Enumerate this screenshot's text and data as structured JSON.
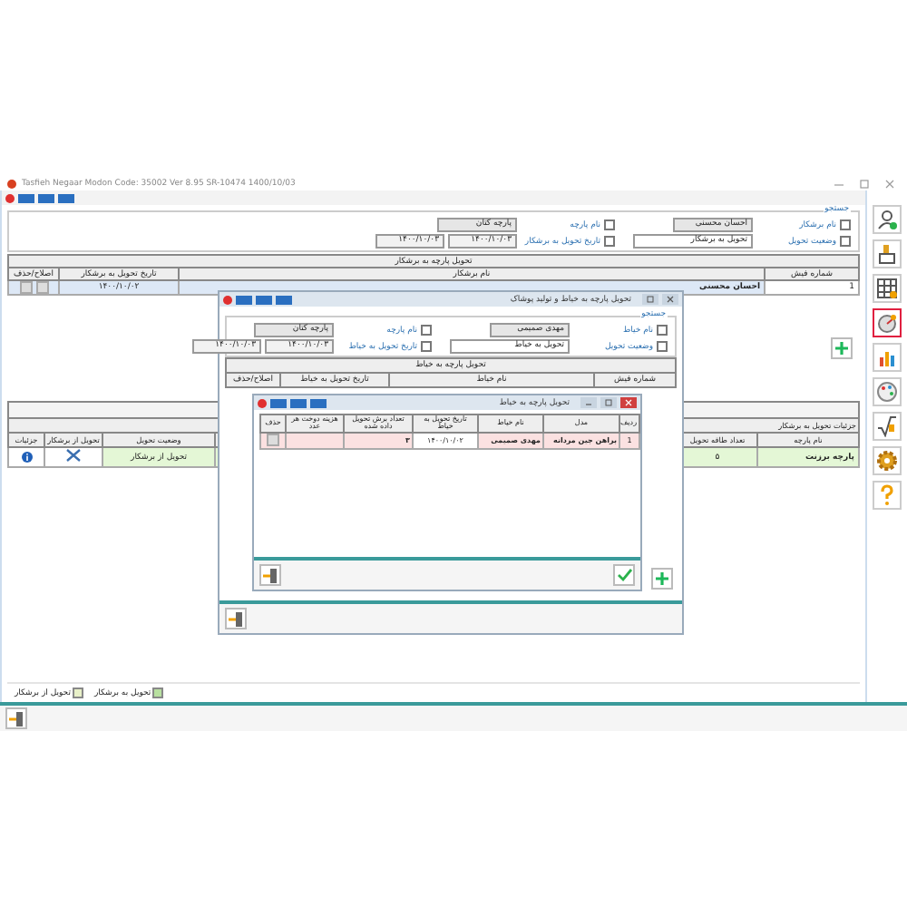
{
  "main_window": {
    "title": "Tasfieh Negaar Modon  Code: 35002  Ver 8.95  SR-10474  1400/10/03",
    "filter": {
      "legend": "جستجو",
      "fields": [
        {
          "label": "نام برشکار",
          "checked": false,
          "kind": "text",
          "value": "احسان محسنی"
        },
        {
          "label": "وضعیت تحویل",
          "checked": false,
          "kind": "select",
          "value": "تحویل به برشکار"
        },
        {
          "label": "نام پارچه",
          "checked": false,
          "kind": "text",
          "value": "پارچه کتان"
        },
        {
          "label": "تاریخ تحویل به برشکار",
          "checked": false,
          "kind": "date-range",
          "from": "۱۴۰۰/۱۰/۰۳",
          "to": "۱۴۰۰/۱۰/۰۳"
        }
      ]
    },
    "deliveries_table": {
      "group": "تحویل پارچه به برشکار",
      "columns": [
        "شماره فیش",
        "نام برشکار",
        "تاریخ تحویل به برشکار",
        "اصلاح/حذف"
      ],
      "rows": [
        {
          "number": "1",
          "name": "احسان محسنی",
          "date": "۱۴۰۰/۱۰/۰۲"
        }
      ]
    },
    "details_table": {
      "group": "جزئیات تحویل به برشکار",
      "columns": [
        "نام پارچه",
        "تعداد طاقه تحویل",
        "",
        "وضعیت تحویل",
        "تحویل از برشکار",
        "جزئیات"
      ],
      "rows": [
        {
          "fabric": "پارچه برزنت",
          "count": "۵",
          "status": "تحویل از برشکار"
        }
      ]
    },
    "legend": [
      {
        "label": "تحویل به برشکار",
        "color": "#b8e0a0"
      },
      {
        "label": "تحویل از برشکار",
        "color": "#e8f0c8"
      }
    ],
    "sidebar": [
      {
        "kind": "user",
        "selected": false
      },
      {
        "kind": "stamp",
        "selected": false
      },
      {
        "kind": "grid",
        "selected": false
      },
      {
        "kind": "gauge",
        "selected": true
      },
      {
        "kind": "chart",
        "selected": false
      },
      {
        "kind": "palette",
        "selected": false
      },
      {
        "kind": "root",
        "selected": false
      },
      {
        "kind": "gear",
        "selected": false
      },
      {
        "kind": "help",
        "selected": false
      }
    ]
  },
  "tailor_dialog": {
    "title": "تحویل پارچه به خیاط و تولید پوشاک",
    "filter": {
      "legend": "جستجو",
      "fields": [
        {
          "label": "نام خیاط",
          "checked": false,
          "kind": "text",
          "value": "مهدی صمیمی"
        },
        {
          "label": "وضعیت تحویل",
          "checked": false,
          "kind": "select",
          "value": "تحویل به خیاط"
        },
        {
          "label": "نام پارچه",
          "checked": false,
          "kind": "text",
          "value": "پارچه کتان"
        },
        {
          "label": "تاریخ تحویل به خیاط",
          "checked": false,
          "kind": "date-range",
          "from": "۱۴۰۰/۱۰/۰۳",
          "to": "۱۴۰۰/۱۰/۰۳"
        }
      ]
    },
    "table": {
      "group": "تحویل پارچه به خیاط",
      "columns": [
        "شماره فیش",
        "نام خیاط",
        "تاریخ تحویل به خیاط",
        "اصلاح/حذف"
      ]
    }
  },
  "cut_dialog": {
    "title": "تحویل پارچه به خیاط",
    "columns": [
      "ردیف",
      "مدل",
      "نام خیاط",
      "تاریخ تحویل به خیاط",
      "تعداد برش تحویل داده شده",
      "هزینه دوخت هر عدد",
      "حذف"
    ],
    "rows": [
      {
        "row": "1",
        "model": "براهن جین مردانه",
        "tailor": "مهدی صمیمی",
        "date": "۱۴۰۰/۱۰/۰۲",
        "count": "۳"
      }
    ]
  }
}
